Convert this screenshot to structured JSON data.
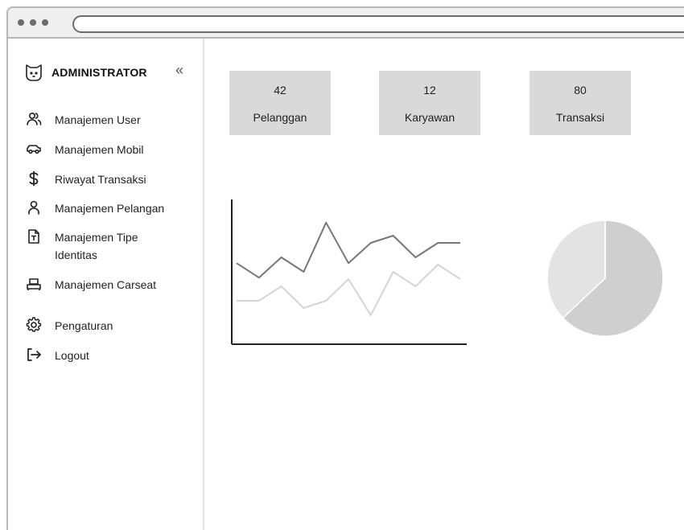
{
  "sidebar": {
    "brand": "ADMINISTRATOR",
    "collapse_glyph": "«",
    "items": [
      {
        "label": "Manajemen User",
        "icon": "users-icon"
      },
      {
        "label": "Manajemen Mobil",
        "icon": "car-icon"
      },
      {
        "label": "Riwayat Transaksi",
        "icon": "dollar-icon"
      },
      {
        "label": "Manajemen Pelangan",
        "icon": "user-icon"
      },
      {
        "label": "Manajemen Tipe Identitas",
        "icon": "id-document-icon"
      },
      {
        "label": "Manajemen Carseat",
        "icon": "carseat-icon"
      },
      {
        "label": "Pengaturan",
        "icon": "gear-icon"
      },
      {
        "label": "Logout",
        "icon": "logout-icon"
      }
    ]
  },
  "stats": [
    {
      "value": "42",
      "label": "Pelanggan"
    },
    {
      "value": "12",
      "label": "Karyawan"
    },
    {
      "value": "80",
      "label": "Transaksi"
    }
  ],
  "colors": {
    "stat_card_bg": "#d9d9d9",
    "line_dark": "#777777",
    "line_light": "#d5d5d5",
    "pie_large": "#cfcfcf",
    "pie_small": "#e3e3e3"
  },
  "chart_data": [
    {
      "type": "line",
      "title": "",
      "xlabel": "",
      "ylabel": "",
      "x": [
        1,
        2,
        3,
        4,
        5,
        6,
        7,
        8,
        9,
        10,
        11
      ],
      "series": [
        {
          "values": [
            5.6,
            4.6,
            6.0,
            5.0,
            8.4,
            5.6,
            7.0,
            7.5,
            6.0,
            7.0,
            7.0
          ]
        },
        {
          "values": [
            3.0,
            3.0,
            4.0,
            2.5,
            3.0,
            4.5,
            2.0,
            5.0,
            4.0,
            5.5,
            4.5
          ]
        }
      ],
      "ylim": [
        0,
        10
      ],
      "grid": false
    },
    {
      "type": "pie",
      "title": "",
      "values": [
        63,
        37
      ]
    }
  ]
}
